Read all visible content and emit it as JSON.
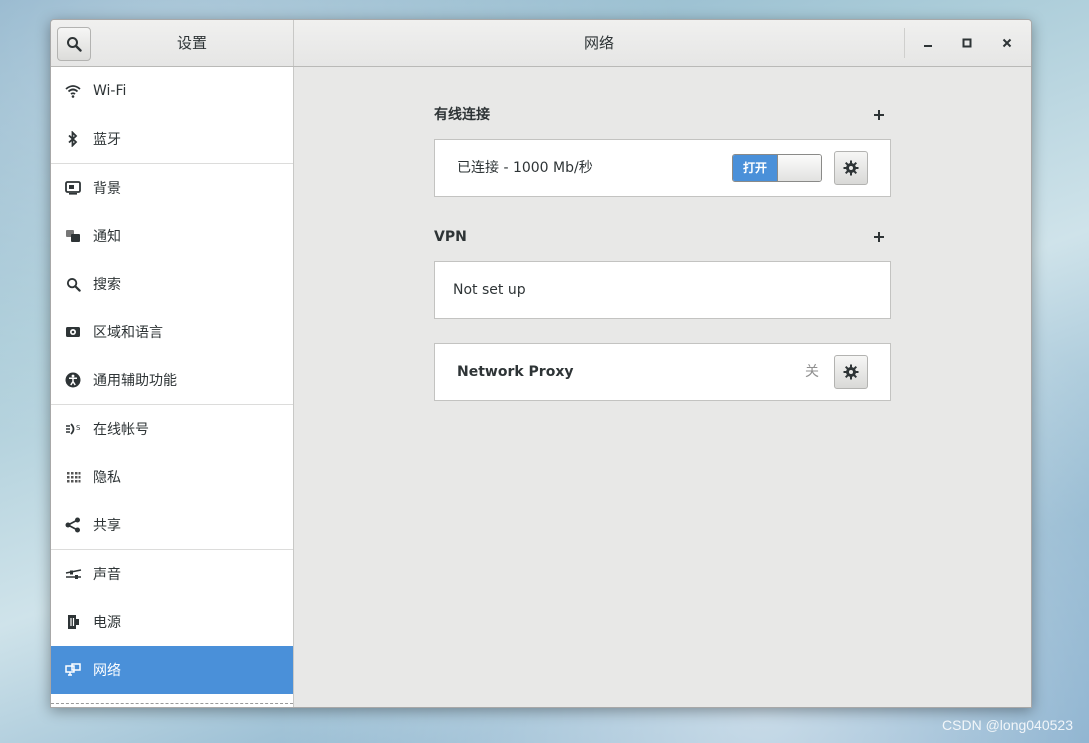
{
  "window": {
    "sidebar_title": "设置",
    "main_title": "网络",
    "controls": {
      "minimize": "minimize-icon",
      "maximize": "maximize-icon",
      "close": "close-icon"
    }
  },
  "sidebar": {
    "items": [
      {
        "label": "Wi-Fi",
        "icon": "wifi-icon"
      },
      {
        "label": "蓝牙",
        "icon": "bluetooth-icon"
      },
      {
        "label": "背景",
        "icon": "background-icon"
      },
      {
        "label": "通知",
        "icon": "notification-icon"
      },
      {
        "label": "搜索",
        "icon": "search-icon"
      },
      {
        "label": "区域和语言",
        "icon": "region-language-icon"
      },
      {
        "label": "通用辅助功能",
        "icon": "accessibility-icon"
      },
      {
        "label": "在线帐号",
        "icon": "online-accounts-icon"
      },
      {
        "label": "隐私",
        "icon": "privacy-icon"
      },
      {
        "label": "共享",
        "icon": "share-icon"
      },
      {
        "label": "声音",
        "icon": "sound-icon"
      },
      {
        "label": "电源",
        "icon": "power-icon"
      },
      {
        "label": "网络",
        "icon": "network-icon"
      }
    ],
    "selected": "网络"
  },
  "main": {
    "wired": {
      "title": "有线连接",
      "status": "已连接 - 1000 Mb/秒",
      "switch_label": "打开",
      "switch_on": true
    },
    "vpn": {
      "title": "VPN",
      "empty_text": "Not set up"
    },
    "proxy": {
      "label": "Network Proxy",
      "state": "关"
    }
  },
  "watermark": "CSDN @long040523",
  "colors": {
    "accent": "#4a90d9",
    "sidebar_bg": "#ffffff",
    "content_bg": "#e8e8e7"
  }
}
